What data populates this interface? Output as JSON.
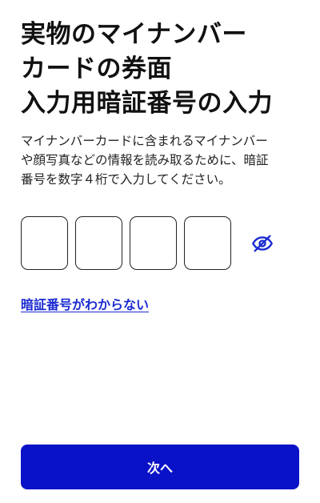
{
  "header": {
    "title": "実物のマイナンバー\nカードの券面\n入力用暗証番号の入力"
  },
  "main": {
    "description": "マイナンバーカードに含まれるマイナンバー\nや顔写真などの情報を読み取るために、暗証\n番号を数字４桁で入力してください。",
    "pin": {
      "digits": [
        "",
        "",
        "",
        ""
      ]
    },
    "visibility_toggle": {
      "icon": "eye-slash-icon",
      "color": "#1a2bd1"
    },
    "forgot_link": "暗証番号がわからない"
  },
  "footer": {
    "next_label": "次へ"
  },
  "colors": {
    "accent": "#0a12c8",
    "link": "#1a2bd1",
    "text": "#111111"
  }
}
